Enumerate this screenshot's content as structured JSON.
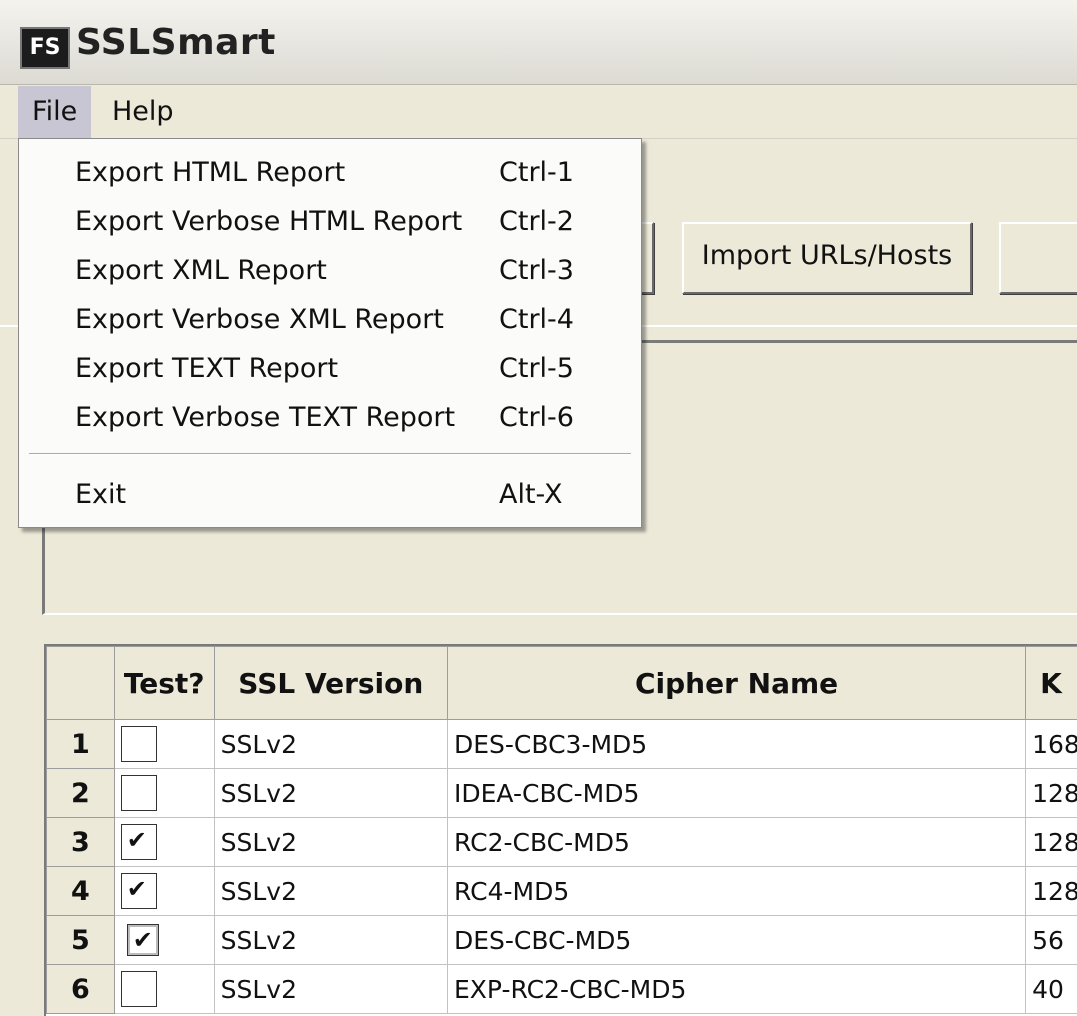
{
  "window": {
    "icon_text": "FS",
    "title": "SSLSmart"
  },
  "menubar": {
    "file": "File",
    "help": "Help"
  },
  "file_menu": {
    "items": [
      {
        "label": "Export HTML Report",
        "shortcut": "Ctrl-1"
      },
      {
        "label": "Export Verbose HTML Report",
        "shortcut": "Ctrl-2"
      },
      {
        "label": "Export XML Report",
        "shortcut": "Ctrl-3"
      },
      {
        "label": "Export Verbose XML Report",
        "shortcut": "Ctrl-4"
      },
      {
        "label": "Export TEXT Report",
        "shortcut": "Ctrl-5"
      },
      {
        "label": "Export Verbose TEXT Report",
        "shortcut": "Ctrl-6"
      }
    ],
    "exit": {
      "label": "Exit",
      "shortcut": "Alt-X"
    }
  },
  "toolbar": {
    "import_label": "Import URLs/Hosts"
  },
  "grid": {
    "columns": [
      "",
      "Test?",
      "SSL Version",
      "Cipher Name",
      "K"
    ],
    "rows": [
      {
        "n": "1",
        "checked": false,
        "version": "SSLv2",
        "cipher": "DES-CBC3-MD5",
        "bits": "168"
      },
      {
        "n": "2",
        "checked": false,
        "version": "SSLv2",
        "cipher": "IDEA-CBC-MD5",
        "bits": "128"
      },
      {
        "n": "3",
        "checked": true,
        "version": "SSLv2",
        "cipher": "RC2-CBC-MD5",
        "bits": "128"
      },
      {
        "n": "4",
        "checked": true,
        "version": "SSLv2",
        "cipher": "RC4-MD5",
        "bits": "128"
      },
      {
        "n": "5",
        "checked": true,
        "version": "SSLv2",
        "cipher": "DES-CBC-MD5",
        "bits": "56"
      },
      {
        "n": "6",
        "checked": false,
        "version": "SSLv2",
        "cipher": "EXP-RC2-CBC-MD5",
        "bits": "40"
      }
    ]
  }
}
